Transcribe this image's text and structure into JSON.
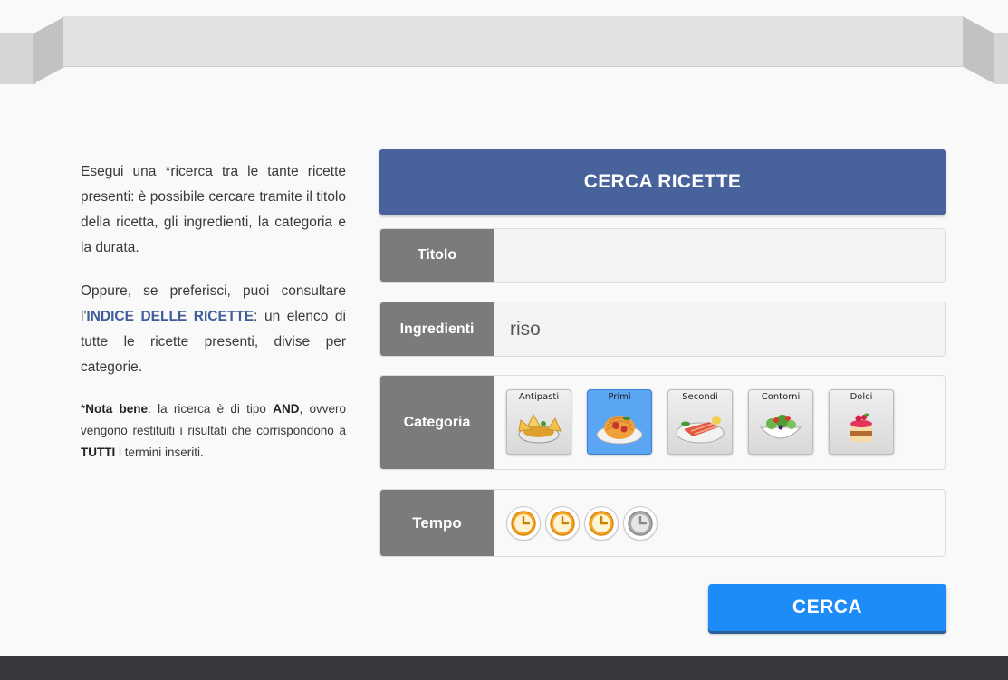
{
  "intro": {
    "p1": "Esegui una *ricerca tra le tante ricette presenti: è possibile cercare tramite il titolo della ricetta, gli ingredienti, la categoria e la durata.",
    "p2_before": "Oppure, se preferisci, puoi consultare l'",
    "p2_link": "INDICE DELLE RICETTE",
    "p2_after": ": un elenco di tutte le ricette presenti, divise per categorie.",
    "note_star": "*",
    "note_bold": "Nota bene",
    "note_text1": ": la ricerca è di tipo ",
    "note_and": "AND",
    "note_text2": ", ovvero vengono restituiti i risultati che corrispondono a ",
    "note_tutti": "TUTTI",
    "note_text3": " i termini inseriti."
  },
  "form": {
    "title": "CERCA RICETTE",
    "titolo_label": "Titolo",
    "titolo_value": "",
    "ingredienti_label": "Ingredienti",
    "ingredienti_value": "riso",
    "categoria_label": "Categoria",
    "categories": [
      {
        "name": "Antipasti",
        "icon": "antipasti-icon",
        "selected": false
      },
      {
        "name": "Primi",
        "icon": "pasta-icon",
        "selected": true
      },
      {
        "name": "Secondi",
        "icon": "salmon-icon",
        "selected": false
      },
      {
        "name": "Contorni",
        "icon": "salad-icon",
        "selected": false
      },
      {
        "name": "Dolci",
        "icon": "cake-icon",
        "selected": false
      }
    ],
    "tempo_label": "Tempo",
    "tempo_level": 3,
    "tempo_max": 4,
    "submit_label": "CERCA"
  },
  "colors": {
    "header": "#48639c",
    "label_bg": "#7b7b7b",
    "button": "#1d8cf8",
    "clock_active": "#f5a623",
    "clock_inactive": "#a8a8a8",
    "footer": "#37393e"
  }
}
